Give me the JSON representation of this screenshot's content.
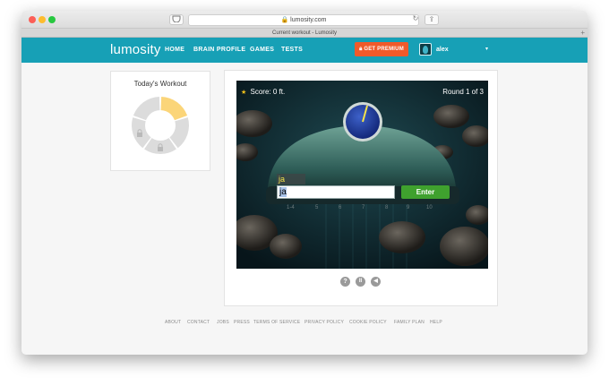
{
  "browser": {
    "url": "lumosity.com",
    "tab_title": "Current workout - Lumosity"
  },
  "nav": {
    "logo": "lumosity",
    "links": [
      "HOME",
      "BRAIN PROFILE",
      "GAMES",
      "TESTS"
    ],
    "premium_label": "GET PREMIUM",
    "username": "alex",
    "caret": "▾"
  },
  "workout": {
    "title": "Today's Workout",
    "segments_total": 5,
    "segments_completed": 1,
    "locked_segments": 2
  },
  "game": {
    "score_label": "Score: 0 ft.",
    "round_label": "Round 1 of 3",
    "previous_word": "ja",
    "input_value": "ja",
    "enter_label": "Enter",
    "number_track": [
      "1-4",
      "5",
      "6",
      "7",
      "8",
      "9",
      "10"
    ],
    "controls": [
      "?",
      "II",
      "◀"
    ]
  },
  "footer": {
    "links": [
      "ABOUT",
      "CONTACT",
      "JOBS",
      "PRESS",
      "TERMS OF SERVICE",
      "PRIVACY POLICY",
      "COOKIE POLICY",
      "FAMILY PLAN",
      "HELP"
    ]
  },
  "colors": {
    "brand": "#17a0b6",
    "premium": "#f15a2a",
    "enter": "#3fa12e",
    "workout_done": "#fbd579"
  }
}
